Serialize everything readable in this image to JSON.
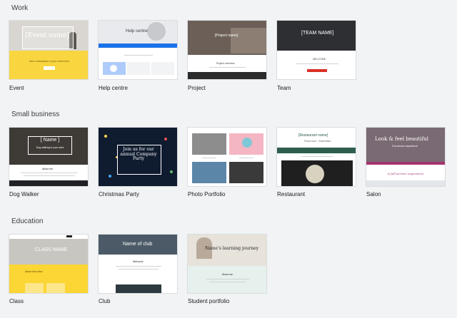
{
  "sections": [
    {
      "title": "Work",
      "templates": [
        "Event",
        "Help centre",
        "Project",
        "Team"
      ]
    },
    {
      "title": "Small business",
      "templates": [
        "Dog Walker",
        "Christmas Party",
        "Photo Portfolio",
        "Restaurant",
        "Salon"
      ]
    },
    {
      "title": "Education",
      "templates": [
        "Class",
        "Club",
        "Student portfolio"
      ]
    }
  ],
  "thumbnails": {
    "event": {
      "heading": "[Event name]",
      "sub": "Add a description of your event here"
    },
    "help": {
      "heading": "Help centre"
    },
    "project": {
      "heading": "[Project name]",
      "section": "Project overview"
    },
    "team": {
      "heading": "[TEAM NAME]",
      "section": "WELCOME"
    },
    "dog": {
      "heading": "[ Name ]",
      "sub": "Dog walking in your area",
      "section": "About me"
    },
    "xmas": {
      "heading": "Join us for our annual Company Party"
    },
    "restaurant": {
      "heading": "[Restaurant name]",
      "sub": "Fresh food · Great taste"
    },
    "salon": {
      "heading": "Look & feel beautiful",
      "sub": "Full-service experience",
      "tagline": "A full-service experience"
    },
    "class": {
      "heading": "CLASS NAME",
      "section": "About this class"
    },
    "club": {
      "heading": "Name of club",
      "section": "Welcome"
    },
    "student": {
      "heading": "Name's learning journey",
      "section": "About me"
    }
  },
  "colors": {
    "background": "#f1f3f4",
    "event_yellow": "#f9d63f",
    "help_blue": "#1a73e8",
    "team_red": "#d93025",
    "restaurant_green": "#2e5e4e",
    "salon_pink": "#a3336e",
    "class_yellow": "#fbd634"
  }
}
